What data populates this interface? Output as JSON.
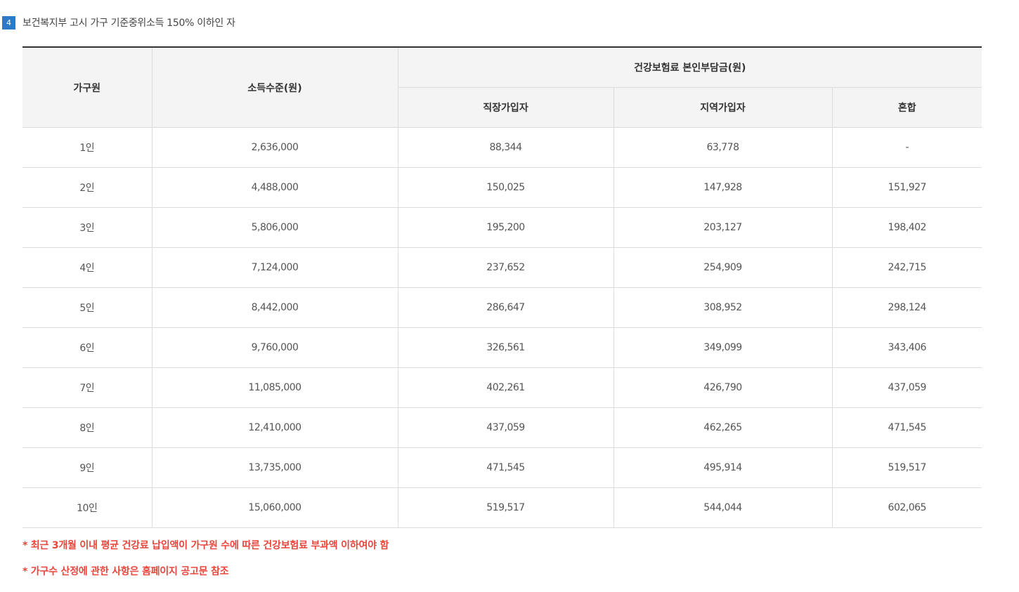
{
  "section": {
    "number": "4",
    "title": "보건복지부 고시 가구 기준중위소득 150% 이하인 자"
  },
  "table": {
    "headers": {
      "household": "가구원",
      "income": "소득수준(원)",
      "premium_group": "건강보험료 본인부담금(원)",
      "employee": "직장가입자",
      "regional": "지역가입자",
      "mixed": "혼합"
    },
    "rows": [
      {
        "members": "1인",
        "income": "2,636,000",
        "employee": "88,344",
        "regional": "63,778",
        "mixed": "-"
      },
      {
        "members": "2인",
        "income": "4,488,000",
        "employee": "150,025",
        "regional": "147,928",
        "mixed": "151,927"
      },
      {
        "members": "3인",
        "income": "5,806,000",
        "employee": "195,200",
        "regional": "203,127",
        "mixed": "198,402"
      },
      {
        "members": "4인",
        "income": "7,124,000",
        "employee": "237,652",
        "regional": "254,909",
        "mixed": "242,715"
      },
      {
        "members": "5인",
        "income": "8,442,000",
        "employee": "286,647",
        "regional": "308,952",
        "mixed": "298,124"
      },
      {
        "members": "6인",
        "income": "9,760,000",
        "employee": "326,561",
        "regional": "349,099",
        "mixed": "343,406"
      },
      {
        "members": "7인",
        "income": "11,085,000",
        "employee": "402,261",
        "regional": "426,790",
        "mixed": "437,059"
      },
      {
        "members": "8인",
        "income": "12,410,000",
        "employee": "437,059",
        "regional": "462,265",
        "mixed": "471,545"
      },
      {
        "members": "9인",
        "income": "13,735,000",
        "employee": "471,545",
        "regional": "495,914",
        "mixed": "519,517"
      },
      {
        "members": "10인",
        "income": "15,060,000",
        "employee": "519,517",
        "regional": "544,044",
        "mixed": "602,065"
      }
    ]
  },
  "notes": [
    "* 최근 3개월 이내 평균 건강료 납입액이 가구원 수에 따른 건강보험료 부과액 이하여야 함",
    "* 가구수 산정에 관한 사항은 홈페이지 공고문 참조"
  ],
  "colors": {
    "badge": "#2b7bc8",
    "note": "#e8453c",
    "header_bg": "#f4f4f4"
  }
}
